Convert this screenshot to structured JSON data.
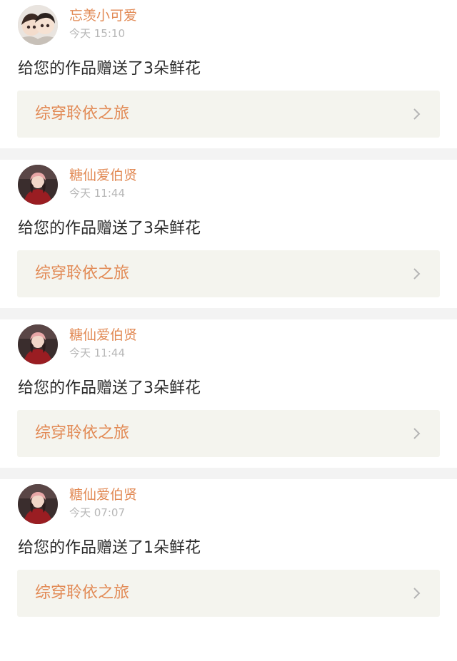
{
  "notifications": [
    {
      "username": "忘羡小可爱",
      "time": "今天 15:10",
      "message": "给您的作品赠送了3朵鲜花",
      "work_title": "综穿聆依之旅",
      "avatar_icon": "cartoon-couple-avatar-icon"
    },
    {
      "username": "糖仙爱伯贤",
      "time": "今天 11:44",
      "message": "给您的作品赠送了3朵鲜花",
      "work_title": "综穿聆依之旅",
      "avatar_icon": "girl-photo-avatar-icon"
    },
    {
      "username": "糖仙爱伯贤",
      "time": "今天 11:44",
      "message": "给您的作品赠送了3朵鲜花",
      "work_title": "综穿聆依之旅",
      "avatar_icon": "girl-photo-avatar-icon"
    },
    {
      "username": "糖仙爱伯贤",
      "time": "今天 07:07",
      "message": "给您的作品赠送了1朵鲜花",
      "work_title": "综穿聆依之旅",
      "avatar_icon": "girl-photo-avatar-icon"
    }
  ],
  "colors": {
    "accent": "#e28a55",
    "timestamp": "#b7b7b7",
    "text": "#2b2b2b",
    "link_bg": "#f4f4ee",
    "separator": "#f3f3f3"
  }
}
